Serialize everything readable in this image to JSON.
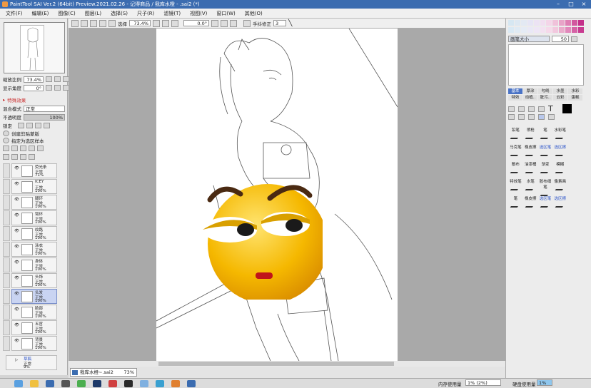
{
  "window": {
    "title": "PaintTool SAI Ver.2 (64bit) Preview.2021.02.26 - 记得商品 / 我库水橙 - .sai2 (*)"
  },
  "menu": [
    "文件(F)",
    "编辑(E)",
    "图像(C)",
    "图层(L)",
    "选择(S)",
    "尺子(R)",
    "滤镜(T)",
    "视图(V)",
    "窗口(W)",
    "其他(O)"
  ],
  "left": {
    "zoom_label": "缩放比例",
    "zoom_value": "73.4%",
    "angle_label": "显示角度",
    "angle_value": "0°",
    "effects_label": "特殊效果",
    "blend_label": "混合模式",
    "blend_value": "正常",
    "opacity_label": "不透明度",
    "opacity_value": "100%",
    "lock_label": "锁定",
    "clip_label": "创建剪贴蒙版",
    "select_label": "指定为选区样本",
    "layers": [
      {
        "name": "荧光条",
        "mode": "正常",
        "opacity": "71%",
        "selected": false
      },
      {
        "name": "ICEY",
        "mode": "正常",
        "opacity": "100%",
        "selected": false
      },
      {
        "name": "腿环",
        "mode": "正常",
        "opacity": "100%",
        "selected": false
      },
      {
        "name": "臂环",
        "mode": "正常",
        "opacity": "100%",
        "selected": false
      },
      {
        "name": "纹路",
        "mode": "正常",
        "opacity": "100%",
        "selected": false
      },
      {
        "name": "泳衣",
        "mode": "正常",
        "opacity": "100%",
        "selected": false
      },
      {
        "name": "身体",
        "mode": "正常",
        "opacity": "100%",
        "selected": false
      },
      {
        "name": "头饰",
        "mode": "正常",
        "opacity": "100%",
        "selected": false
      },
      {
        "name": "头发",
        "mode": "正常",
        "opacity": "100%",
        "selected": true
      },
      {
        "name": "脸部",
        "mode": "正常",
        "opacity": "100%",
        "selected": false
      },
      {
        "name": "五官",
        "mode": "正常",
        "opacity": "100%",
        "selected": false
      },
      {
        "name": "背景",
        "mode": "正常",
        "opacity": "100%",
        "selected": false
      }
    ],
    "folder": {
      "name": "草稿",
      "mode": "正常",
      "opacity": "9%"
    }
  },
  "toolbar": {
    "select_label": "选择",
    "zoom": "73.4%",
    "angle": "0.0°",
    "stabilizer_label": "手抖修正",
    "stabilizer_value": "3"
  },
  "right": {
    "brush_size_label": "画笔大小",
    "brush_size_value": "50",
    "tabs": [
      "基本",
      "厚涂",
      "勾线",
      "水墨",
      "水彩",
      "特效",
      "动植..",
      "脏污..",
      "云彩",
      "蛋糕"
    ],
    "tools": [
      {
        "label": "铅笔",
        "active": false
      },
      {
        "label": "喷枪",
        "active": false
      },
      {
        "label": "笔",
        "active": false
      },
      {
        "label": "水彩笔",
        "active": false
      },
      {
        "label": "",
        "active": false
      },
      {
        "label": "马克笔",
        "active": false
      },
      {
        "label": "橡皮擦",
        "active": false
      },
      {
        "label": "选区笔",
        "active": true
      },
      {
        "label": "选区擦",
        "active": true
      },
      {
        "label": "",
        "active": false
      },
      {
        "label": "散布",
        "active": false
      },
      {
        "label": "油漆桶",
        "active": false
      },
      {
        "label": "渐变",
        "active": false
      },
      {
        "label": "模糊",
        "active": false
      },
      {
        "label": "",
        "active": false
      },
      {
        "label": "特效笔",
        "active": false
      },
      {
        "label": "水笔",
        "active": false
      },
      {
        "label": "胶布细笔",
        "active": false
      },
      {
        "label": "像素画",
        "active": false
      },
      {
        "label": "",
        "active": false
      },
      {
        "label": "笔",
        "active": false
      },
      {
        "label": "橡皮擦",
        "active": false
      },
      {
        "label": "选区笔",
        "active": true
      },
      {
        "label": "选区擦",
        "active": true
      },
      {
        "label": "",
        "active": false
      }
    ]
  },
  "doc_tab": {
    "name": "我库水橙~.sai2",
    "zoom": "73%"
  },
  "status": {
    "mem_label": "内存使用量",
    "mem_value": "1% (2%)",
    "disk_label": "硬盘使用量",
    "disk_value": "1%"
  },
  "colors": {
    "titlebar": "#3b6cb0",
    "accent": "#4a73c6",
    "canvas_bg": "#a9a9a9",
    "emoji": "#f5b800"
  }
}
